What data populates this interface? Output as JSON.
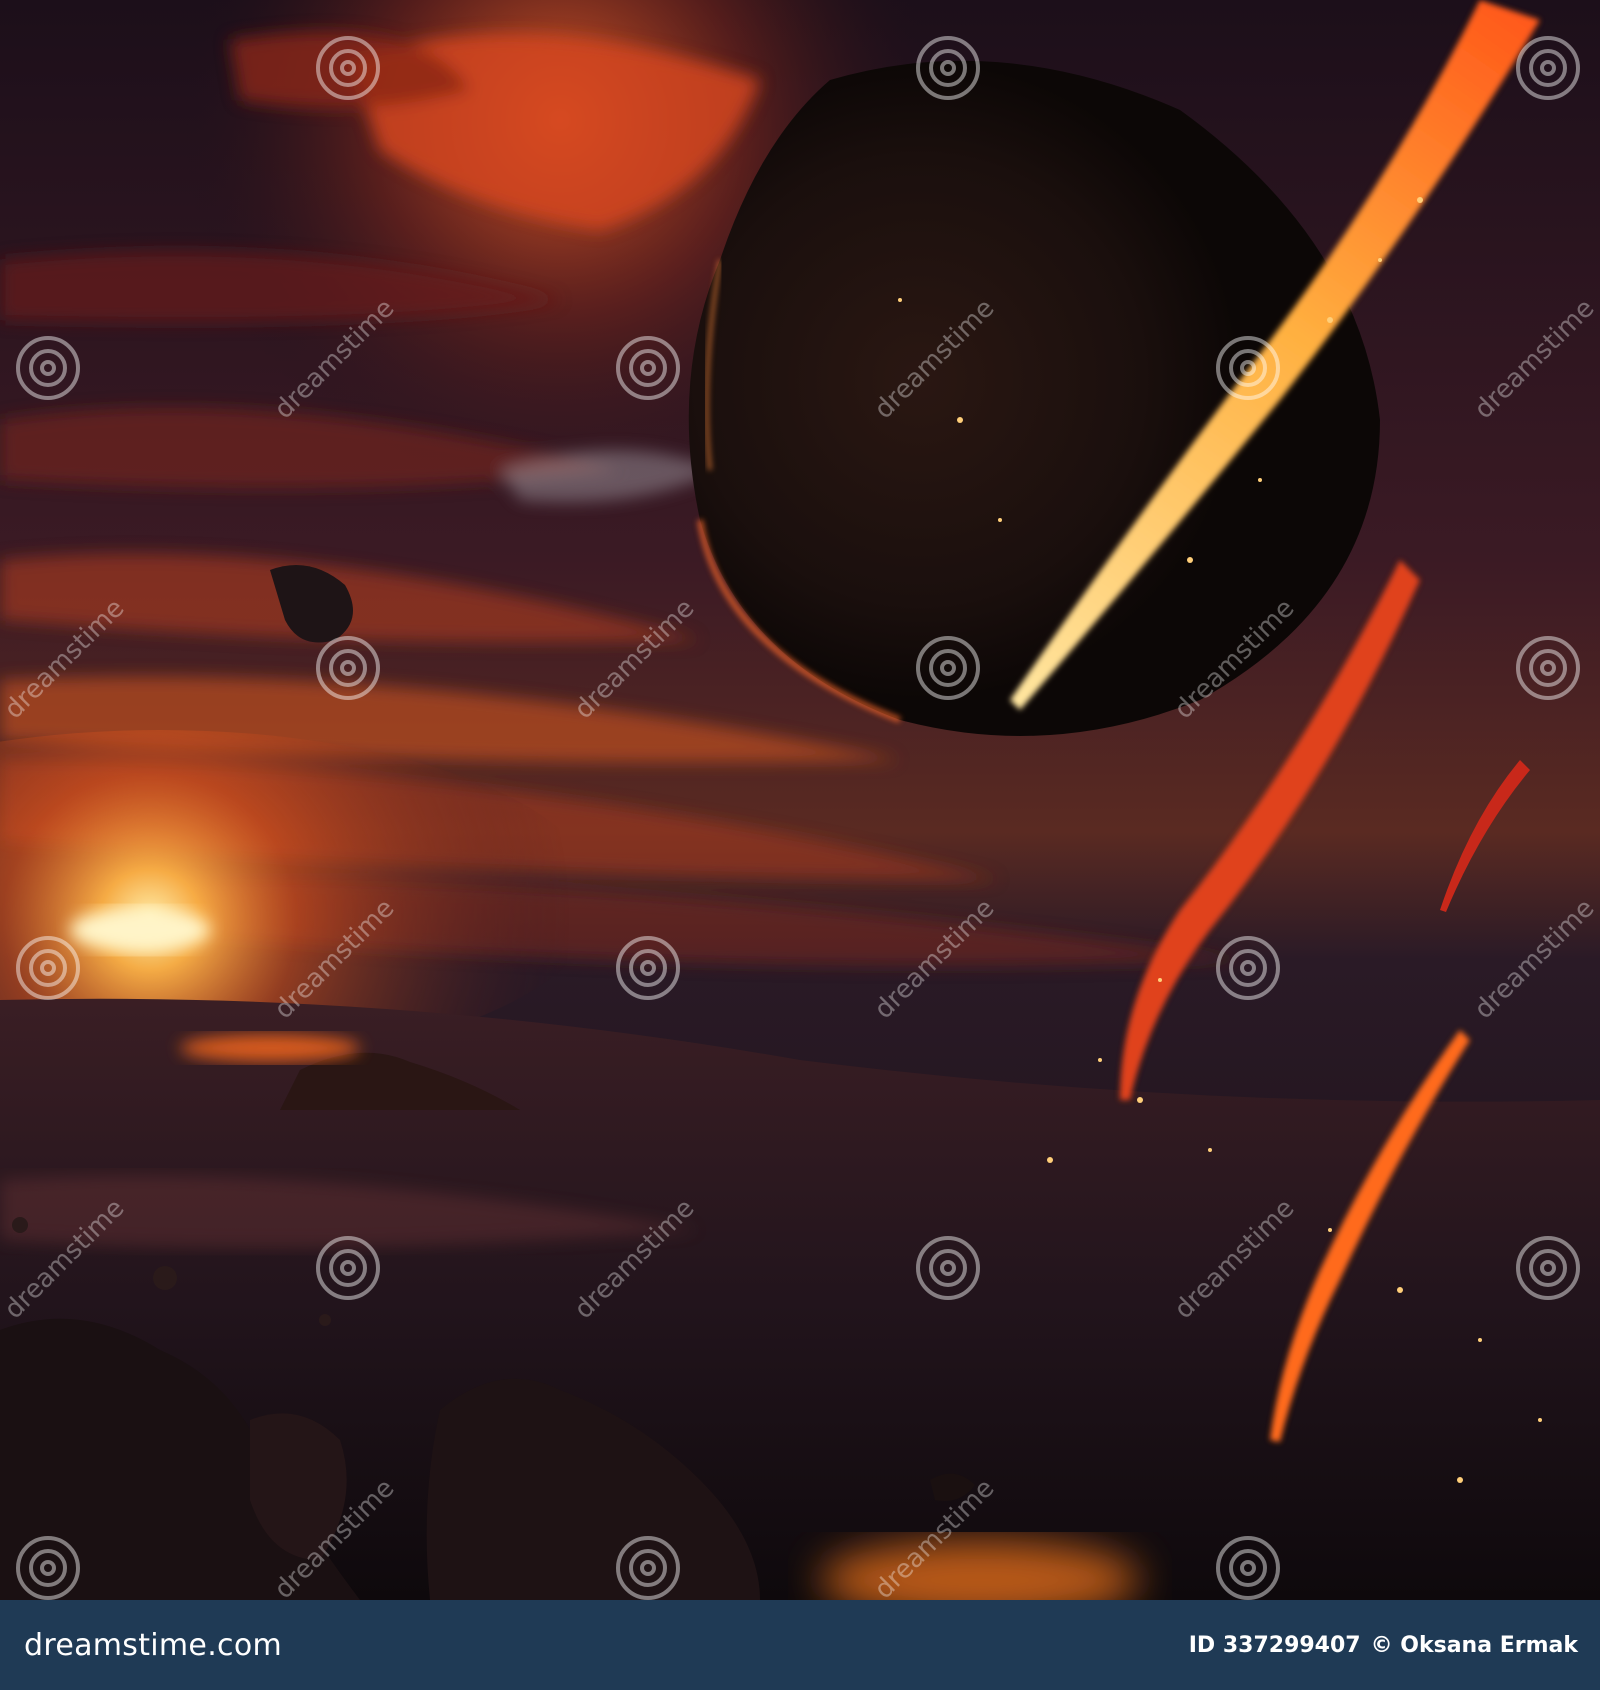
{
  "scene": {
    "description_icon": "meteor-impact-scene",
    "palette": {
      "sky_dark": "#1a1020",
      "sky_mid": "#3a1a22",
      "glow_orange": "#ff7a1f",
      "glow_yellow": "#ffd27a",
      "fire_red": "#c8281a",
      "ground_dark": "#120c10"
    }
  },
  "watermark": {
    "word": "dreamstime",
    "icon": "spiral-watermark-icon"
  },
  "footer": {
    "brand": "dreamstime.com",
    "image_id": "ID 337299407",
    "author": "© Oksana Ermak",
    "background": "#1f3a55"
  }
}
